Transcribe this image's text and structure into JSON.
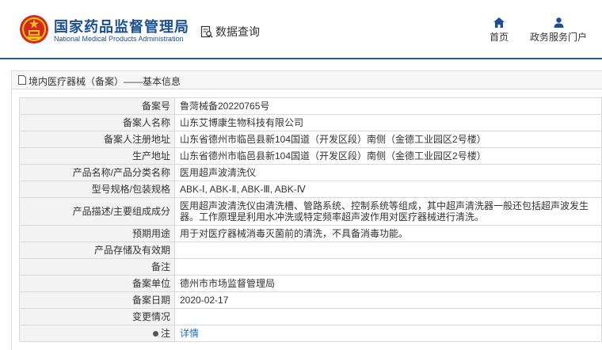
{
  "header": {
    "title_cn": "国家药品监督管理局",
    "title_en": "National Medical Products Administration",
    "query_label": "数据查询",
    "nav": {
      "home": "首页",
      "portal": "政务服务门户"
    }
  },
  "panel": {
    "title": "境内医疗器械（备案）——基本信息"
  },
  "rows": [
    {
      "label": "备案号",
      "value": "鲁菏械备20220765号"
    },
    {
      "label": "备案人名称",
      "value": "山东艾博康生物科技有限公司"
    },
    {
      "label": "备案人注册地址",
      "value": "山东省德州市临邑县新104国道（开发区段）南侧（金德工业园区2号楼）"
    },
    {
      "label": "生产地址",
      "value": "山东省德州市临邑县新104国道（开发区段）南侧（金德工业园区2号楼）"
    },
    {
      "label": "产品名称/产品分类名称",
      "value": "医用超声波清洗仪"
    },
    {
      "label": "型号规格/包装规格",
      "value": "ABK-Ⅰ, ABK-Ⅱ, ABK-Ⅲ, ABK-Ⅳ"
    },
    {
      "label": "产品描述/主要组成成分",
      "value": "医用超声波清洗仪由清洗槽、管路系统、控制系统等组成，其中超声清洗器一般还包括超声波发生器。工作原理是利用水冲洗或特定频率超声波作用对医疗器械进行清洗。"
    },
    {
      "label": "预期用途",
      "value": "用于对医疗器械消毒灭菌前的清洗，不具备消毒功能。"
    },
    {
      "label": "产品存储及有效期",
      "value": ""
    },
    {
      "label": "备注",
      "value": ""
    },
    {
      "label": "备案单位",
      "value": "德州市市场监督管理局"
    },
    {
      "label": "备案日期",
      "value": "2020-02-17"
    },
    {
      "label": "变更情况",
      "value": ""
    },
    {
      "label": "注",
      "value": "详情"
    }
  ],
  "colors": {
    "brand_blue": "#1c4f91",
    "link_blue": "#1f6fc5",
    "emblem_red": "#d22a1e"
  }
}
